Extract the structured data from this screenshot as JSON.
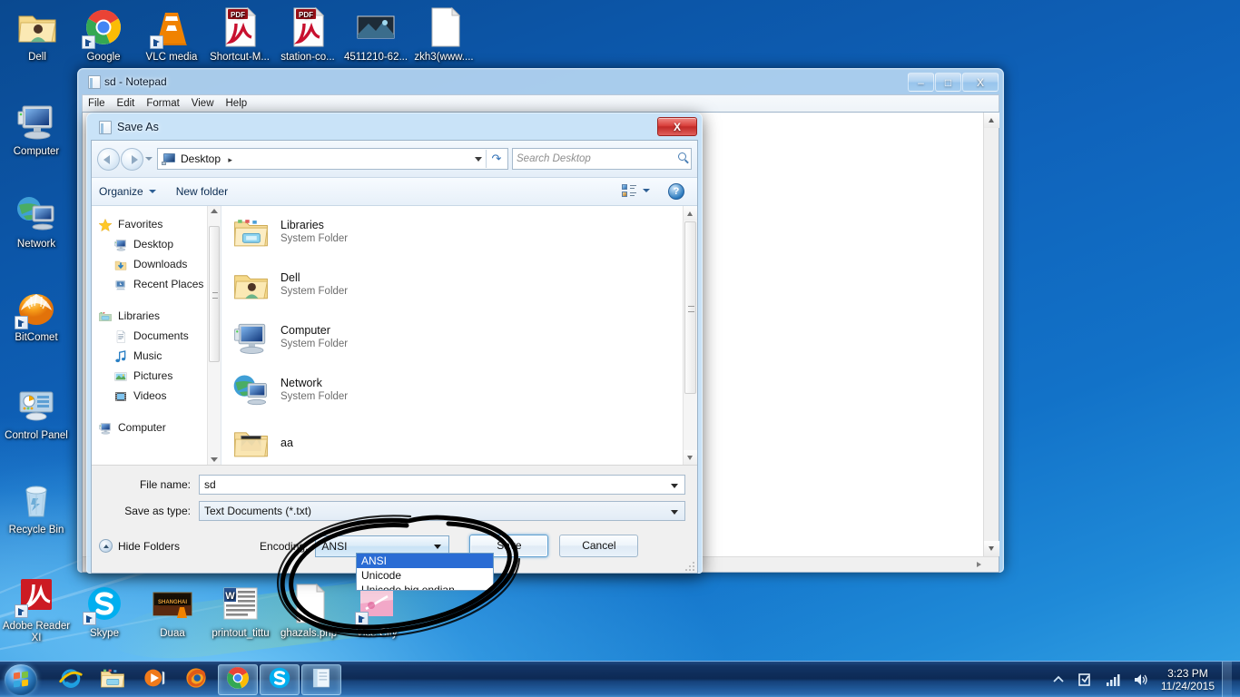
{
  "desktop": {
    "icons_top": [
      {
        "label": "Dell",
        "icon": "folder-user-icon"
      },
      {
        "label": "Google",
        "icon": "chrome-icon"
      },
      {
        "label": "VLC media",
        "icon": "vlc-cone-icon"
      },
      {
        "label": "Shortcut-M...",
        "icon": "pdf-document-icon"
      },
      {
        "label": "station-co...",
        "icon": "pdf-document-icon"
      },
      {
        "label": "4511210-62...",
        "icon": "image-thumbnail-icon"
      },
      {
        "label": "zkh3(www....",
        "icon": "blank-document-icon"
      }
    ],
    "icons_left": [
      {
        "label": "Computer",
        "icon": "computer-icon"
      },
      {
        "label": "Network",
        "icon": "network-icon"
      },
      {
        "label": "BitComet",
        "icon": "bitcomet-icon"
      },
      {
        "label": "Control Panel",
        "icon": "control-panel-icon"
      },
      {
        "label": "Recycle Bin",
        "icon": "recycle-bin-icon"
      },
      {
        "label": "Adobe Reader XI",
        "icon": "adobe-reader-icon"
      }
    ],
    "icons_bottom": [
      {
        "label": "Skype",
        "icon": "skype-icon"
      },
      {
        "label": "Duaa",
        "icon": "video-thumbnail-icon"
      },
      {
        "label": "printout_tittu",
        "icon": "word-document-icon"
      },
      {
        "label": "ghazals.php",
        "icon": "blank-document-icon"
      },
      {
        "label": "Vice City",
        "icon": "game-shortcut-icon"
      }
    ]
  },
  "notepad": {
    "title": "sd - Notepad",
    "menu": [
      "File",
      "Edit",
      "Format",
      "View",
      "Help"
    ],
    "minimize": "–",
    "maximize": "□",
    "close": "X",
    "text": ""
  },
  "save_as": {
    "title": "Save As",
    "close": "X",
    "address": {
      "crumb_root": "Desktop",
      "separator": "▸",
      "refresh_icon": "refresh-icon",
      "caret_icon": "chevron-down-icon"
    },
    "search": {
      "placeholder": "Search Desktop",
      "icon": "search-icon"
    },
    "toolbar": {
      "organize": "Organize",
      "new_folder": "New folder",
      "view_icon": "view-layout-icon",
      "help_icon": "help-icon",
      "help_glyph": "?"
    },
    "nav_tree": [
      {
        "group": "Favorites",
        "icon": "star-icon",
        "items": [
          {
            "label": "Desktop",
            "icon": "desktop-icon"
          },
          {
            "label": "Downloads",
            "icon": "downloads-icon"
          },
          {
            "label": "Recent Places",
            "icon": "recent-places-icon"
          }
        ]
      },
      {
        "group": "Libraries",
        "icon": "libraries-icon",
        "items": [
          {
            "label": "Documents",
            "icon": "documents-icon"
          },
          {
            "label": "Music",
            "icon": "music-icon"
          },
          {
            "label": "Pictures",
            "icon": "pictures-icon"
          },
          {
            "label": "Videos",
            "icon": "videos-icon"
          }
        ]
      },
      {
        "group": "Computer",
        "icon": "computer-icon",
        "items": []
      }
    ],
    "files": [
      {
        "name": "Libraries",
        "sub": "System Folder",
        "icon": "libraries-folder-icon"
      },
      {
        "name": "Dell",
        "sub": "System Folder",
        "icon": "user-folder-icon"
      },
      {
        "name": "Computer",
        "sub": "System Folder",
        "icon": "computer-icon"
      },
      {
        "name": "Network",
        "sub": "System Folder",
        "icon": "network-icon"
      },
      {
        "name": "aa",
        "sub": "",
        "icon": "picture-folder-icon"
      }
    ],
    "form": {
      "file_name_label": "File name:",
      "file_name_value": "sd",
      "save_as_type_label": "Save as type:",
      "save_as_type_value": "Text Documents (*.txt)",
      "hide_folders_label": "Hide Folders",
      "encoding_label": "Encoding:",
      "encoding_value": "ANSI",
      "save_button": "Save",
      "cancel_button": "Cancel"
    },
    "encoding_dropdown": {
      "open": true,
      "options": [
        "ANSI",
        "Unicode",
        "Unicode big endian"
      ],
      "selected": "ANSI",
      "highlight_color": "#2a6cd4"
    }
  },
  "annotation": {
    "type": "hand-drawn-circle",
    "color": "#000000",
    "target": "encoding-combobox"
  },
  "taskbar": {
    "start_label": "Start",
    "pinned": [
      {
        "name": "internet-explorer-icon",
        "active": false
      },
      {
        "name": "windows-explorer-icon",
        "active": false
      },
      {
        "name": "windows-media-player-icon",
        "active": false
      },
      {
        "name": "firefox-icon",
        "active": false
      },
      {
        "name": "chrome-icon",
        "active": true
      },
      {
        "name": "skype-icon",
        "active": true
      },
      {
        "name": "notepad-icon",
        "active": true
      }
    ],
    "tray": {
      "show_hidden_icon": "chevron-up-icon",
      "action_center_icon": "action-center-icon",
      "network_icon": "network-signal-icon",
      "volume_icon": "volume-icon"
    },
    "clock_time": "3:23 PM",
    "clock_date": "11/24/2015"
  },
  "colors": {
    "accent": "#2a6cd4",
    "close_red": "#c22a28",
    "desktop_blue": "#0f63bb"
  }
}
